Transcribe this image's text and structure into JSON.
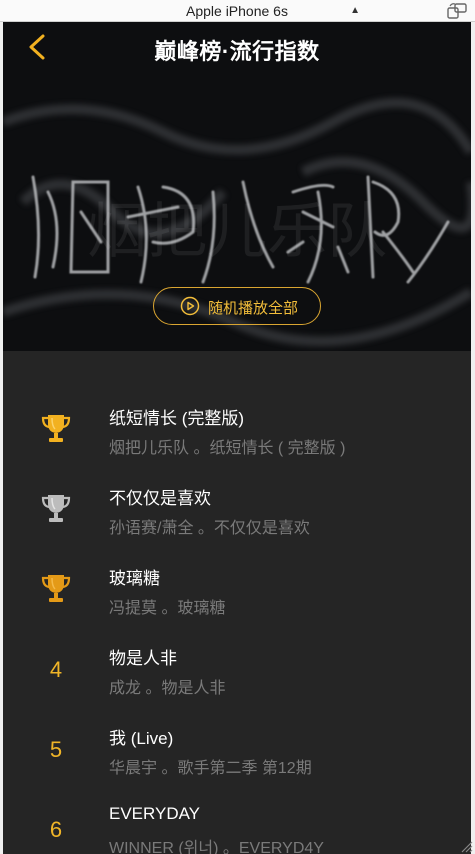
{
  "device": {
    "name": "Apple iPhone 6s"
  },
  "header": {
    "title": "巅峰榜·流行指数"
  },
  "hero": {
    "art_text": "烟把儿乐队",
    "play_all_label": "随机播放全部"
  },
  "songs": [
    {
      "rank": "1",
      "trophy": "gold-trophy",
      "title": "纸短情长 (完整版)",
      "subtitle": "烟把儿乐队 。纸短情长 ( 完整版 )"
    },
    {
      "rank": "2",
      "trophy": "silver-trophy",
      "title": "不仅仅是喜欢",
      "subtitle": "孙语赛/萧全 。不仅仅是喜欢"
    },
    {
      "rank": "3",
      "trophy": "bronze-trophy",
      "title": "玻璃糖",
      "subtitle": "冯提莫 。玻璃糖"
    },
    {
      "rank": "4",
      "title": "物是人非",
      "subtitle": "成龙 。物是人非"
    },
    {
      "rank": "5",
      "title": "我 (Live)",
      "subtitle": "华晨宇 。歌手第二季 第12期"
    },
    {
      "rank": "6",
      "title": "EVERYDAY",
      "subtitle": "WINNER (위너) 。EVERYD4Y"
    }
  ],
  "colors": {
    "accent": "#f0b528",
    "gold": "#f2b120",
    "silver": "#bcbcbc",
    "bronze": "#e49a17",
    "list_bg": "#252525"
  }
}
